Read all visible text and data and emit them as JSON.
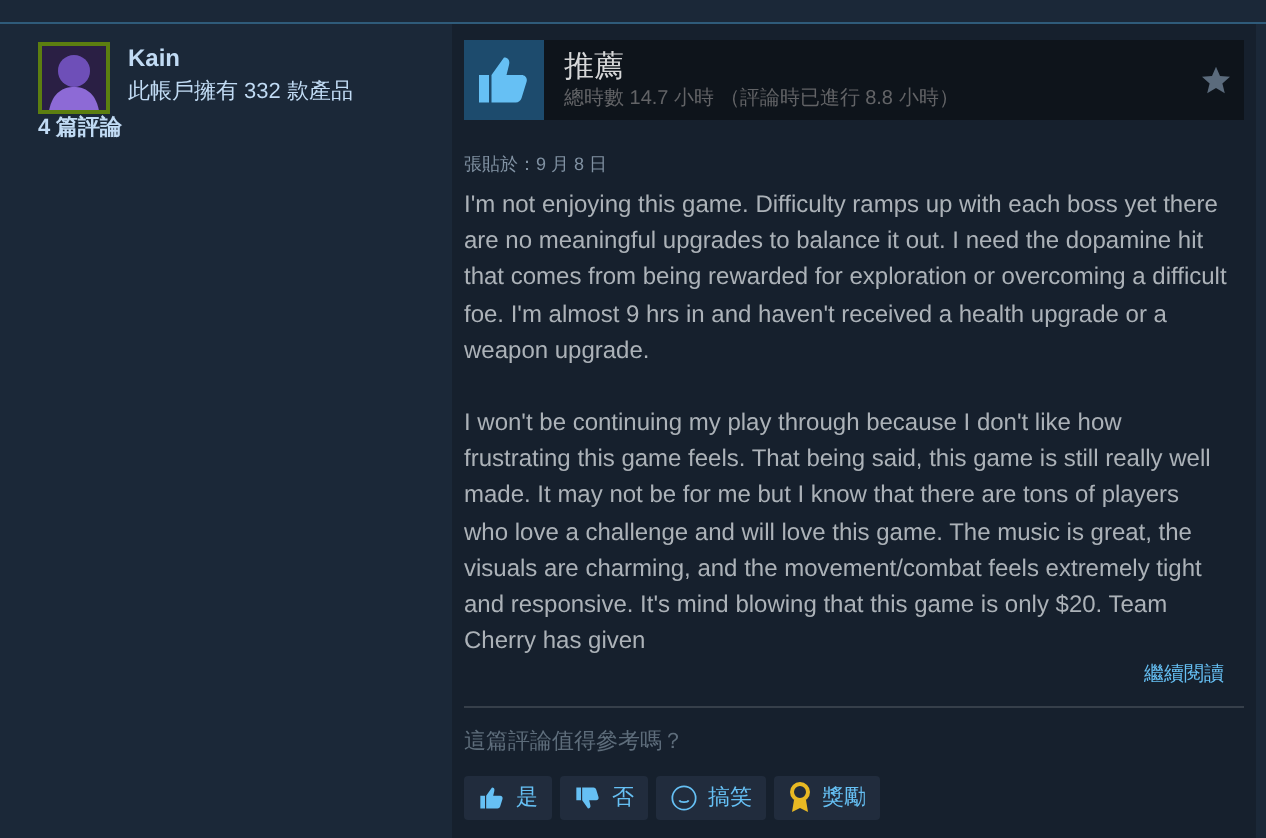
{
  "reviewer": {
    "name": "Kain",
    "products": "此帳戶擁有 332 款產品",
    "reviews": "4 篇評論"
  },
  "review": {
    "verdict": "推薦",
    "recommended": true,
    "hours": "總時數 14.7 小時 （評論時已進行 8.8 小時）",
    "posted": "張貼於：9 月 8 日",
    "paragraphs": [
      "I'm not enjoying this game. Difficulty ramps up with each boss yet there are no meaningful upgrades to balance it out. I need the dopamine hit that comes from being rewarded for exploration or overcoming a difficult foe. I'm almost 9 hrs in and haven't received a health upgrade or a weapon upgrade.",
      "I won't be continuing my play through because I don't like how frustrating this game feels. That being said, this game is still really well made. It may not be for me but I know that there are tons of players who love a challenge and will love this game. The music is great, the visuals are charming, and the movement/combat feels extremely tight and responsive. It's mind blowing that this game is only $20. Team Cherry has given"
    ],
    "read_more": "繼續閱讀",
    "helpful_prompt": "這篇評論值得參考嗎？",
    "buttons": [
      {
        "kind": "yes",
        "label": "是"
      },
      {
        "kind": "no",
        "label": "否"
      },
      {
        "kind": "funny",
        "label": "搞笑"
      },
      {
        "kind": "award",
        "label": "獎勵"
      }
    ]
  }
}
